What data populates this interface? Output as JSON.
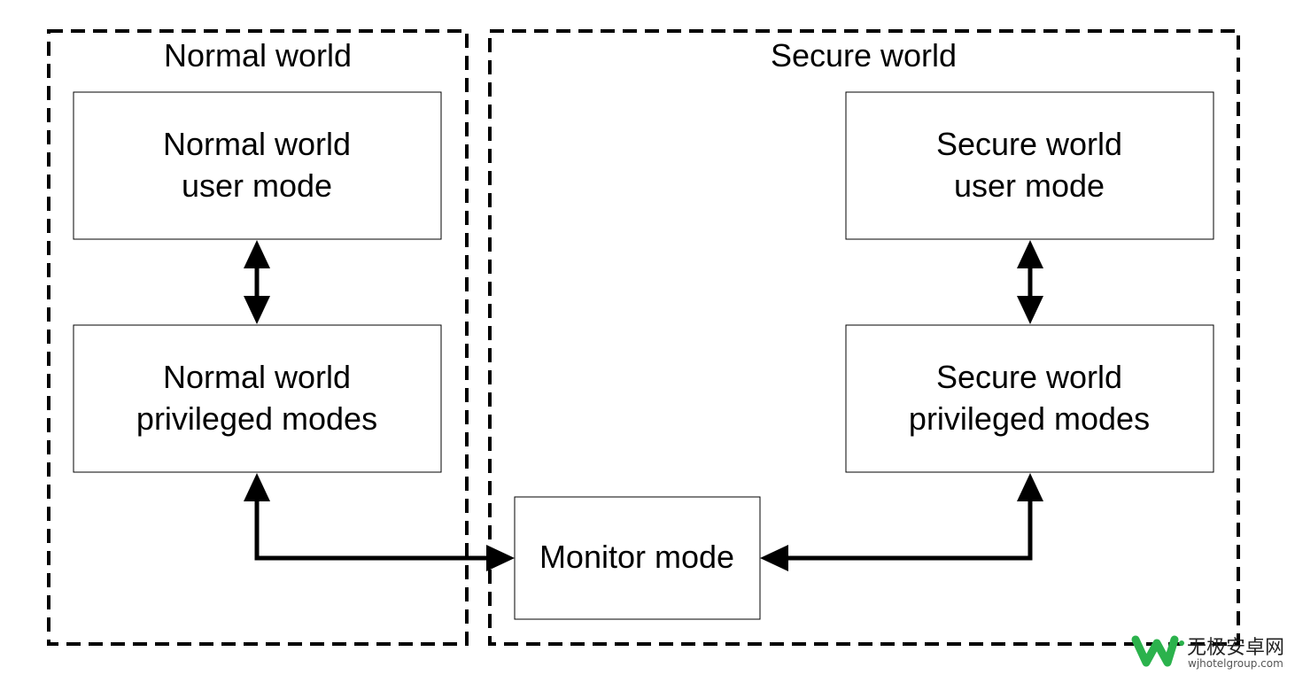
{
  "regions": {
    "normal_world": "Normal world",
    "secure_world": "Secure world"
  },
  "boxes": {
    "normal_user": [
      "Normal world",
      "user mode"
    ],
    "normal_priv": [
      "Normal world",
      "privileged modes"
    ],
    "secure_user": [
      "Secure world",
      "user mode"
    ],
    "secure_priv": [
      "Secure world",
      "privileged modes"
    ],
    "monitor": "Monitor mode"
  },
  "colors": {
    "stroke": "#000000",
    "watermark": "#2bb24c"
  },
  "watermark": {
    "cn": "无极安卓网",
    "en": "wjhotelgroup.com"
  }
}
